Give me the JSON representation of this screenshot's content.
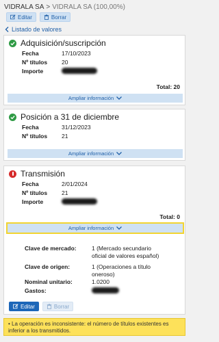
{
  "breadcrumb": {
    "company": "VIDRALA SA",
    "separator": ">",
    "current": "VIDRALA SA (100,00%)"
  },
  "toolbar": {
    "edit_label": "Editar",
    "delete_label": "Borrar"
  },
  "back_link": {
    "label": "Listado de valores"
  },
  "expand_label": "Ampliar información",
  "cards": [
    {
      "title": "Adquisición/suscripción",
      "status": "ok",
      "rows": [
        {
          "label": "Fecha",
          "value": "17/10/2023"
        },
        {
          "label": "Nº títulos",
          "value": "20"
        },
        {
          "label": "Importe",
          "value": ""
        }
      ],
      "total_label": "Total:",
      "total_value": "20"
    },
    {
      "title": "Posición a 31 de diciembre",
      "status": "ok",
      "rows": [
        {
          "label": "Fecha",
          "value": "31/12/2023"
        },
        {
          "label": "Nº títulos",
          "value": "21"
        }
      ]
    },
    {
      "title": "Transmisión",
      "status": "error",
      "rows": [
        {
          "label": "Fecha",
          "value": "2/01/2024"
        },
        {
          "label": "Nº títulos",
          "value": "21"
        },
        {
          "label": "Importe",
          "value": ""
        }
      ],
      "total_label": "Total:",
      "total_value": "0",
      "details": [
        {
          "label": "Clave de mercado:",
          "value": "1 (Mercado secundario oficial de valores español)"
        },
        {
          "label": "Clave de origen:",
          "value": "1 (Operaciones a título oneroso)"
        },
        {
          "label": "Nominal unitario:",
          "value": "1.0200"
        },
        {
          "label": "Gastos:",
          "value": ""
        }
      ]
    }
  ],
  "bottom_toolbar": {
    "edit_label": "Editar",
    "delete_label": "Borrar"
  },
  "warning": {
    "text": "La operación es inconsistente: el número de títulos existentes es inferior a los transmitidos."
  },
  "colors": {
    "accent": "#1c66b8",
    "ok": "#2e9a44",
    "error": "#d62b2b",
    "warning": "#fde15a"
  }
}
